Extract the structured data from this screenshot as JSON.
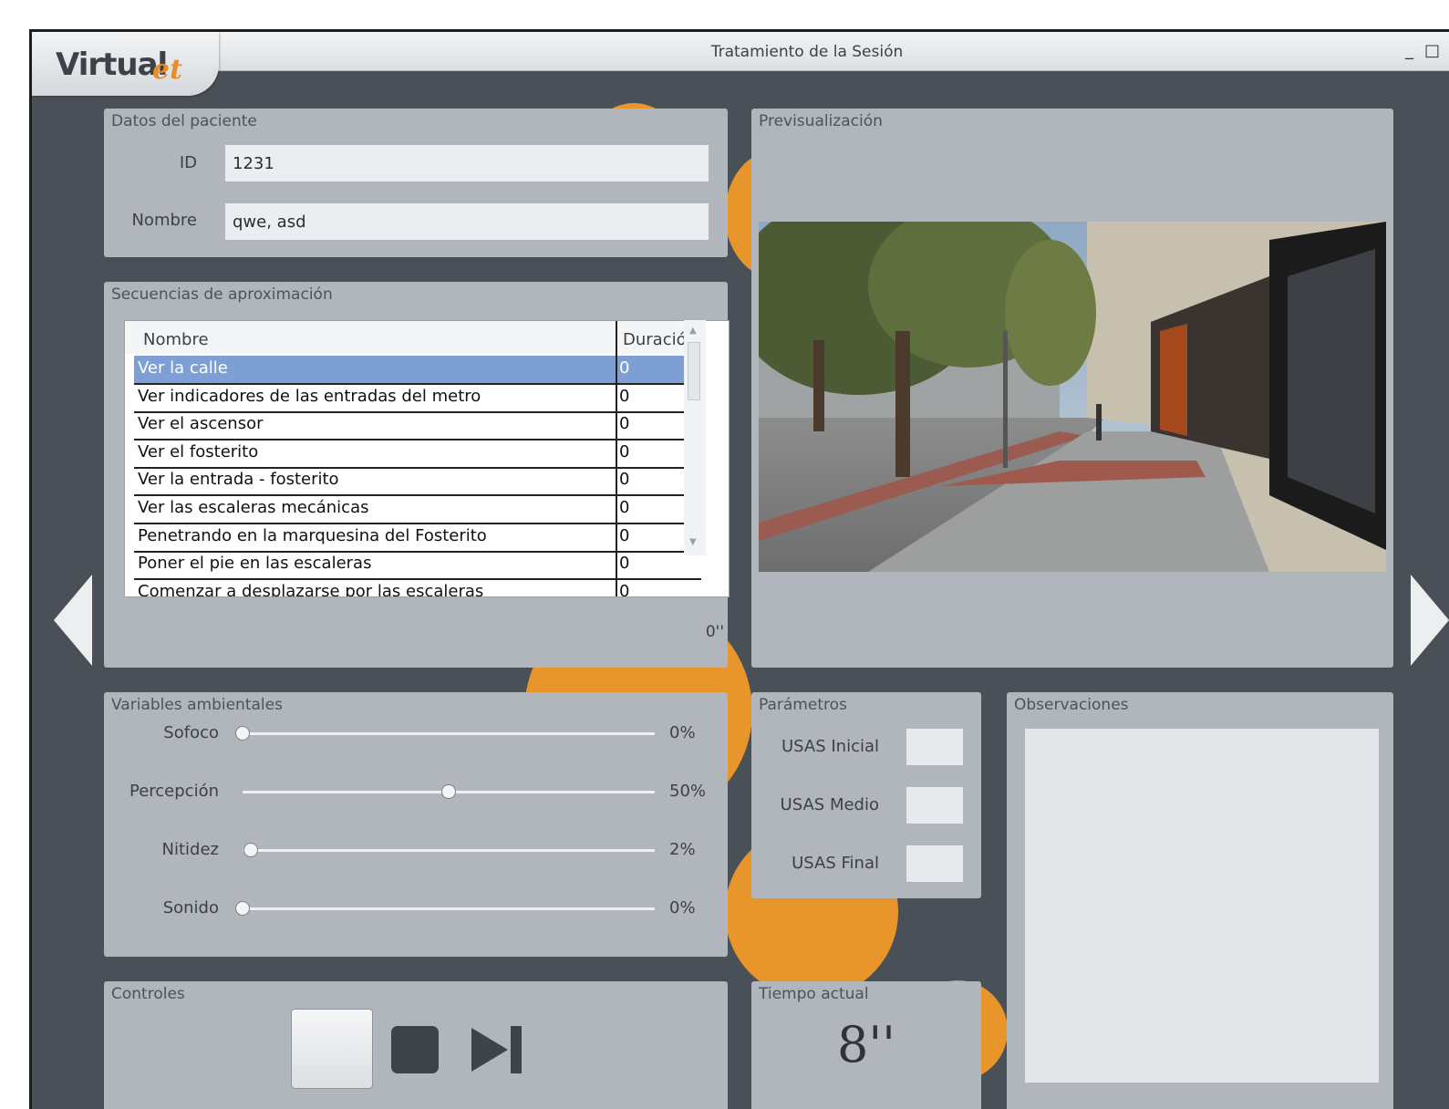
{
  "app": {
    "logo_main": "Virtual",
    "logo_sub": "et",
    "window_title": "Tratamiento de la Sesión"
  },
  "window_controls": {
    "minimize": "_",
    "maximize": "□"
  },
  "patient": {
    "title": "Datos del paciente",
    "id_label": "ID",
    "id_value": "1231",
    "name_label": "Nombre",
    "name_value": "qwe, asd"
  },
  "preview": {
    "title": "Previsualización"
  },
  "sequences": {
    "title": "Secuencias de aproximación",
    "columns": [
      "Nombre",
      "Duración"
    ],
    "rows": [
      {
        "name": "Ver la calle",
        "duration": "0"
      },
      {
        "name": "Ver indicadores de las entradas del metro",
        "duration": "0"
      },
      {
        "name": "Ver el ascensor",
        "duration": "0"
      },
      {
        "name": "Ver el fosterito",
        "duration": "0"
      },
      {
        "name": "Ver la entrada - fosterito",
        "duration": "0"
      },
      {
        "name": "Ver las escaleras mecánicas",
        "duration": "0"
      },
      {
        "name": "Penetrando en la marquesina del Fosterito",
        "duration": "0"
      },
      {
        "name": "Poner el pie en las escaleras",
        "duration": "0"
      },
      {
        "name": "Comenzar a desplazarse por las escaleras",
        "duration": "0"
      }
    ],
    "selected_index": 0,
    "total_time": "0''"
  },
  "env": {
    "title": "Variables ambientales",
    "sliders": [
      {
        "label": "Sofoco",
        "value": 0,
        "display": "0%"
      },
      {
        "label": "Percepción",
        "value": 50,
        "display": "50%"
      },
      {
        "label": "Nitidez",
        "value": 2,
        "display": "2%"
      },
      {
        "label": "Sonido",
        "value": 0,
        "display": "0%"
      }
    ]
  },
  "params": {
    "title": "Parámetros",
    "items": [
      {
        "label": "USAS Inicial",
        "value": ""
      },
      {
        "label": "USAS Medio",
        "value": ""
      },
      {
        "label": "USAS Final",
        "value": ""
      }
    ]
  },
  "observations": {
    "title": "Observaciones",
    "value": ""
  },
  "controls": {
    "title": "Controles"
  },
  "time": {
    "title": "Tiempo actual",
    "value": "8''"
  },
  "colors": {
    "accent": "#e8952c",
    "panel": "#b1b6bc",
    "background": "#4a5058",
    "selection": "#7d9fd3"
  },
  "icons": {
    "play": "play-button-blank",
    "stop": "stop-icon",
    "next": "skip-next-icon",
    "nav_left": "chevron-left-icon",
    "nav_right": "chevron-right-icon"
  }
}
